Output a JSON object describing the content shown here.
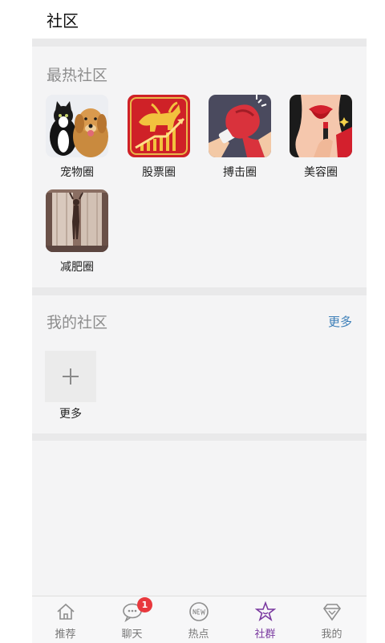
{
  "header": {
    "title": "社区"
  },
  "hot": {
    "title": "最热社区",
    "items": [
      {
        "label": "宠物圈",
        "icon": "pet-cat-dog-icon"
      },
      {
        "label": "股票圈",
        "icon": "stock-bull-icon"
      },
      {
        "label": "搏击圈",
        "icon": "boxing-glove-icon"
      },
      {
        "label": "美容圈",
        "icon": "beauty-lipstick-icon"
      },
      {
        "label": "减肥圈",
        "icon": "slim-silhouette-icon"
      }
    ]
  },
  "mine": {
    "title": "我的社区",
    "more_link": "更多",
    "add_label": "更多",
    "add_icon": "plus-icon"
  },
  "tabs": [
    {
      "label": "推荐",
      "icon": "home-icon",
      "active": false
    },
    {
      "label": "聊天",
      "icon": "chat-icon",
      "active": false,
      "badge": "1"
    },
    {
      "label": "热点",
      "icon": "new-badge-icon",
      "active": false
    },
    {
      "label": "社群",
      "icon": "star-icon",
      "active": true
    },
    {
      "label": "我的",
      "icon": "diamond-icon",
      "active": false
    }
  ],
  "colors": {
    "accent": "#7a3aa0",
    "badge": "#e8383d",
    "link": "#3d7fb8"
  }
}
